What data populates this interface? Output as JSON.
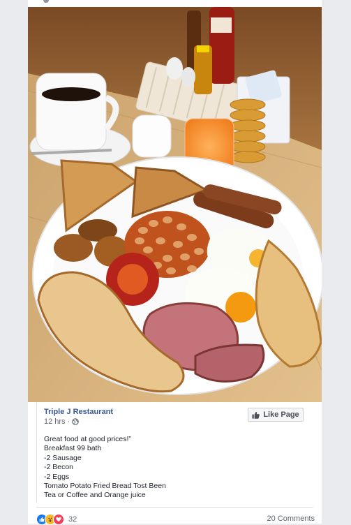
{
  "post": {
    "page_name": "Triple J Restaurant",
    "time": "12 hrs",
    "like_page_label": "Like Page",
    "text_lines": [
      "Great food at good prices!”",
      "Breakfast 99 bath",
      "-2 Sausage",
      "-2 Becon",
      "-2 Eggs",
      "Tomato Potato Fried Bread Tost Been",
      "Tea or Coffee and Orange juice"
    ],
    "reaction_count": "32",
    "comments_label": "20 Comments"
  },
  "colors": {
    "link": "#365899",
    "background": "#e9ebee",
    "like_blue": "#1877f2",
    "wow_yellow": "#f7b928",
    "love_red": "#f33e58"
  },
  "icons": {
    "privacy": "globe-icon",
    "like_button": "thumbs-up-icon",
    "reactions": [
      "like-reaction-icon",
      "wow-reaction-icon",
      "love-reaction-icon"
    ]
  }
}
